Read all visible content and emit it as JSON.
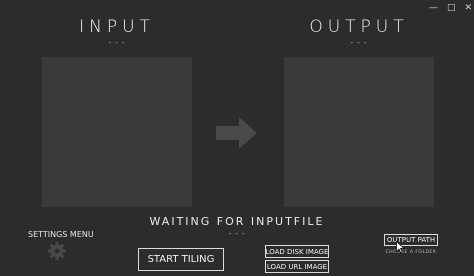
{
  "window": {
    "minimize_glyph": "—",
    "maximize_glyph": "□",
    "close_glyph": "✕"
  },
  "input": {
    "title": "INPUT",
    "subtitle": "- - -"
  },
  "output": {
    "title": "OUTPUT",
    "subtitle": "- - -"
  },
  "status": {
    "text": "WAITING FOR INPUTFILE",
    "subtitle": "- - -"
  },
  "settings": {
    "label": "SETTINGS MENU",
    "icon": "gear-icon"
  },
  "buttons": {
    "start_tiling": "START TILING",
    "load_disk_image": "LOAD DISK IMAGE",
    "load_url_image": "LOAD URL IMAGE",
    "output_path": "OUTPUT PATH"
  },
  "output_path_hint": "CHOOSE A FOLDER",
  "icons": {
    "arrow": "arrow-right-icon"
  },
  "colors": {
    "background": "#2c2c2c",
    "panel": "#3a3a3a",
    "arrow": "#4a4a4a",
    "text": "#e6e6e6"
  }
}
